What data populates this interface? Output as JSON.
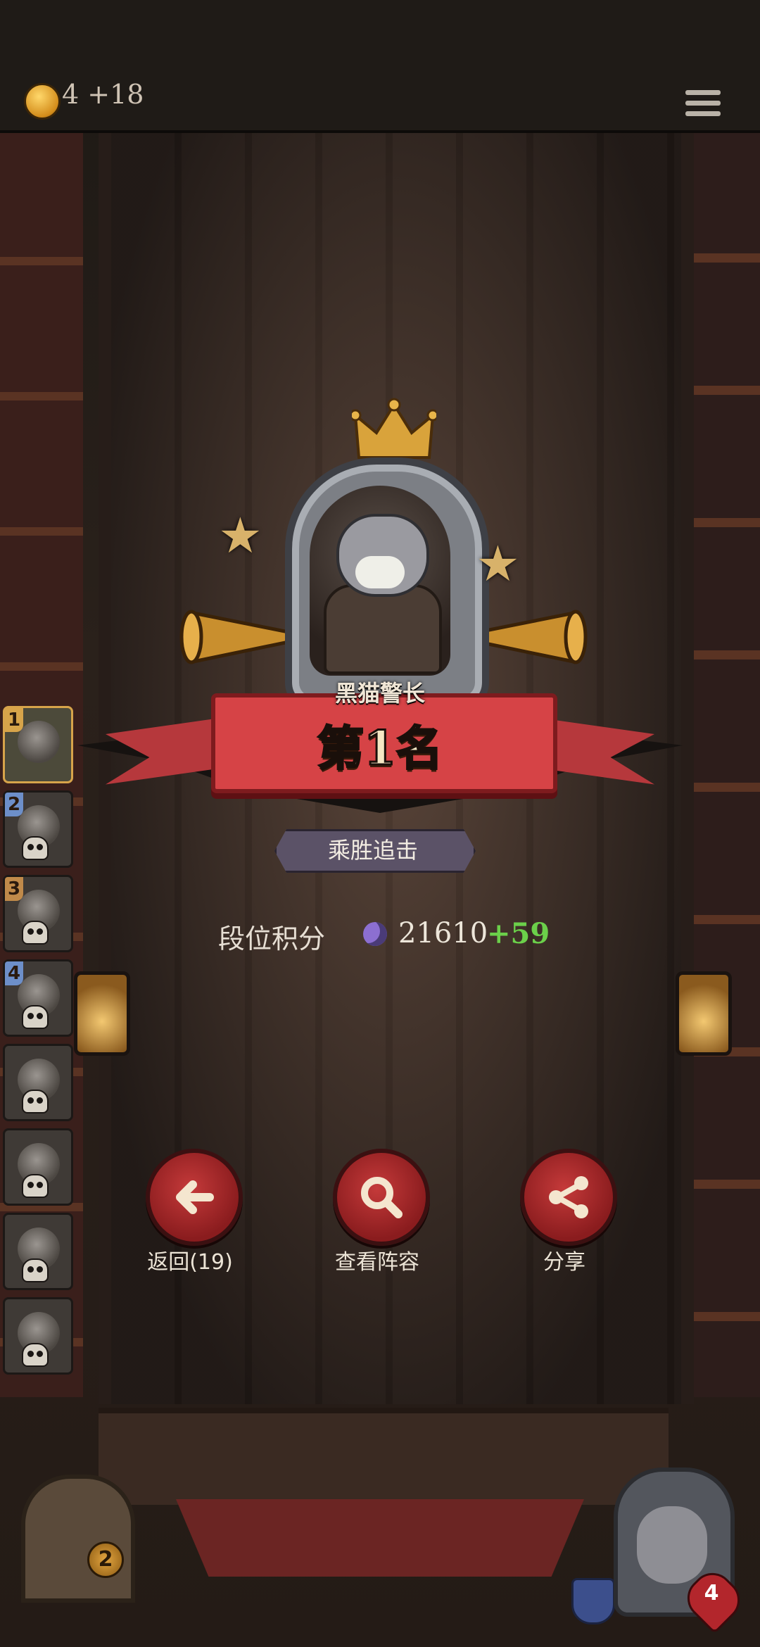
{
  "topbar": {
    "coins": "4 +18",
    "menu_icon": "hamburger-menu-icon"
  },
  "players": [
    {
      "rank": "1",
      "color": "#d7a44a"
    },
    {
      "rank": "2",
      "color": "#6d8fc9"
    },
    {
      "rank": "3",
      "color": "#c08a4a"
    },
    {
      "rank": "4",
      "color": "#6d8fc9"
    },
    {
      "rank": ""
    },
    {
      "rank": ""
    },
    {
      "rank": ""
    },
    {
      "rank": ""
    }
  ],
  "result": {
    "hero_name": "黑猫警长",
    "placement": "第1名",
    "title_tag": "乘胜追击"
  },
  "score": {
    "label": "段位积分",
    "value": "21610",
    "delta": "+59"
  },
  "actions": {
    "back_label": "返回(19)",
    "view_lineup_label": "查看阵容",
    "share_label": "分享"
  },
  "bottom": {
    "door_badge": "2",
    "hero_health": "4"
  },
  "colors": {
    "accent_red": "#c53a3a",
    "gain_green": "#6bd04a"
  }
}
